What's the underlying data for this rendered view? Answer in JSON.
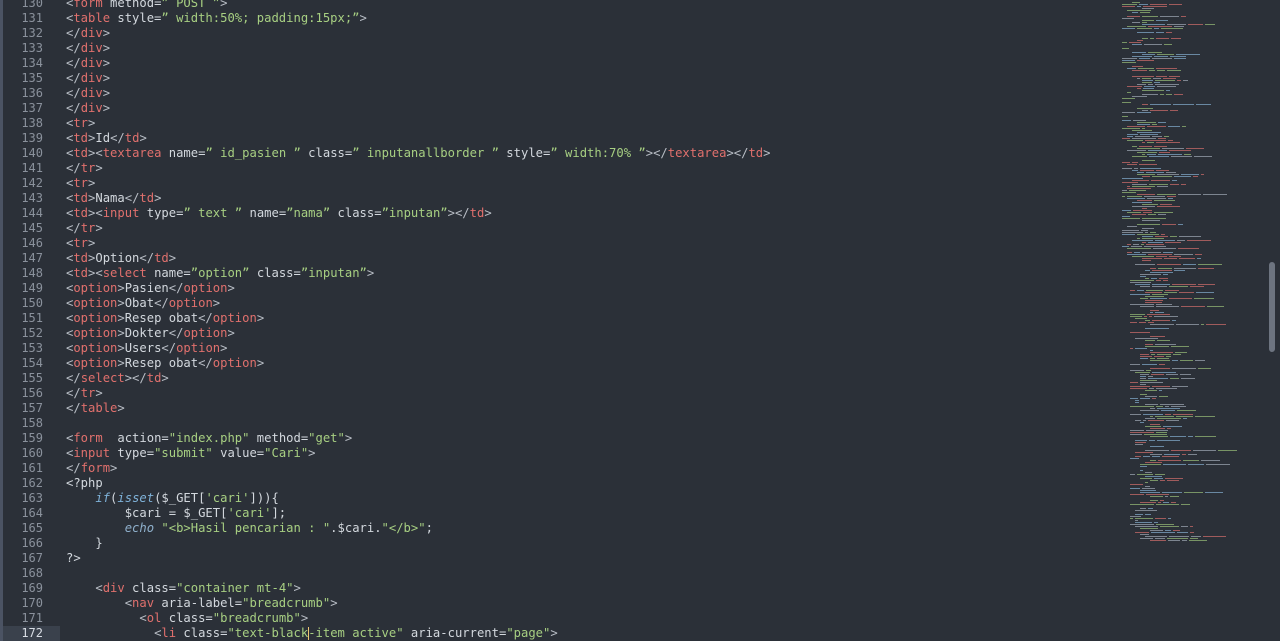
{
  "editor": {
    "active_line": "172",
    "lines": [
      {
        "n": "130",
        "tokens": [
          [
            "br",
            "<"
          ],
          [
            "tag",
            "form"
          ],
          [
            "attr",
            " method="
          ],
          [
            "str",
            "” POST ”"
          ],
          [
            "br",
            ">"
          ]
        ]
      },
      {
        "n": "131",
        "tokens": [
          [
            "br",
            "<"
          ],
          [
            "tag",
            "table"
          ],
          [
            "attr",
            " style="
          ],
          [
            "str",
            "” width:50%; padding:15px;”"
          ],
          [
            "br",
            ">"
          ]
        ]
      },
      {
        "n": "132",
        "tokens": [
          [
            "br",
            "</"
          ],
          [
            "tag",
            "div"
          ],
          [
            "br",
            ">"
          ]
        ]
      },
      {
        "n": "133",
        "tokens": [
          [
            "br",
            "</"
          ],
          [
            "tag",
            "div"
          ],
          [
            "br",
            ">"
          ]
        ]
      },
      {
        "n": "134",
        "tokens": [
          [
            "br",
            "</"
          ],
          [
            "tag",
            "div"
          ],
          [
            "br",
            ">"
          ]
        ]
      },
      {
        "n": "135",
        "tokens": [
          [
            "br",
            "</"
          ],
          [
            "tag",
            "div"
          ],
          [
            "br",
            ">"
          ]
        ]
      },
      {
        "n": "136",
        "tokens": [
          [
            "br",
            "</"
          ],
          [
            "tag",
            "div"
          ],
          [
            "br",
            ">"
          ]
        ]
      },
      {
        "n": "137",
        "tokens": [
          [
            "br",
            "</"
          ],
          [
            "tag",
            "div"
          ],
          [
            "br",
            ">"
          ]
        ]
      },
      {
        "n": "138",
        "tokens": [
          [
            "br",
            "<"
          ],
          [
            "tag",
            "tr"
          ],
          [
            "br",
            ">"
          ]
        ]
      },
      {
        "n": "139",
        "tokens": [
          [
            "br",
            "<"
          ],
          [
            "tag",
            "td"
          ],
          [
            "br",
            ">"
          ],
          [
            "text",
            "Id"
          ],
          [
            "br",
            "</"
          ],
          [
            "tag",
            "td"
          ],
          [
            "br",
            ">"
          ]
        ]
      },
      {
        "n": "140",
        "tokens": [
          [
            "br",
            "<"
          ],
          [
            "tag",
            "td"
          ],
          [
            "br",
            "><"
          ],
          [
            "tag",
            "textarea"
          ],
          [
            "attr",
            " name="
          ],
          [
            "str",
            "” id_pasien ”"
          ],
          [
            "attr",
            " class="
          ],
          [
            "str",
            "” inputanallborder ”"
          ],
          [
            "attr",
            " style="
          ],
          [
            "str",
            "” width:70% ”"
          ],
          [
            "br",
            "></"
          ],
          [
            "tag",
            "textarea"
          ],
          [
            "br",
            "></"
          ],
          [
            "tag",
            "td"
          ],
          [
            "br",
            ">"
          ]
        ]
      },
      {
        "n": "141",
        "tokens": [
          [
            "br",
            "</"
          ],
          [
            "tag",
            "tr"
          ],
          [
            "br",
            ">"
          ]
        ]
      },
      {
        "n": "142",
        "tokens": [
          [
            "br",
            "<"
          ],
          [
            "tag",
            "tr"
          ],
          [
            "br",
            ">"
          ]
        ]
      },
      {
        "n": "143",
        "tokens": [
          [
            "br",
            "<"
          ],
          [
            "tag",
            "td"
          ],
          [
            "br",
            ">"
          ],
          [
            "text",
            "Nama"
          ],
          [
            "br",
            "</"
          ],
          [
            "tag",
            "td"
          ],
          [
            "br",
            ">"
          ]
        ]
      },
      {
        "n": "144",
        "tokens": [
          [
            "br",
            "<"
          ],
          [
            "tag",
            "td"
          ],
          [
            "br",
            "><"
          ],
          [
            "tag",
            "input"
          ],
          [
            "attr",
            " type="
          ],
          [
            "str",
            "” text ”"
          ],
          [
            "attr",
            " name="
          ],
          [
            "str",
            "”nama”"
          ],
          [
            "attr",
            " class="
          ],
          [
            "str",
            "”inputan”"
          ],
          [
            "br",
            "></"
          ],
          [
            "tag",
            "td"
          ],
          [
            "br",
            ">"
          ]
        ]
      },
      {
        "n": "145",
        "tokens": [
          [
            "br",
            "</"
          ],
          [
            "tag",
            "tr"
          ],
          [
            "br",
            ">"
          ]
        ]
      },
      {
        "n": "146",
        "tokens": [
          [
            "br",
            "<"
          ],
          [
            "tag",
            "tr"
          ],
          [
            "br",
            ">"
          ]
        ]
      },
      {
        "n": "147",
        "tokens": [
          [
            "br",
            "<"
          ],
          [
            "tag",
            "td"
          ],
          [
            "br",
            ">"
          ],
          [
            "text",
            "Option"
          ],
          [
            "br",
            "</"
          ],
          [
            "tag",
            "td"
          ],
          [
            "br",
            ">"
          ]
        ]
      },
      {
        "n": "148",
        "tokens": [
          [
            "br",
            "<"
          ],
          [
            "tag",
            "td"
          ],
          [
            "br",
            "><"
          ],
          [
            "tag",
            "select"
          ],
          [
            "attr",
            " name="
          ],
          [
            "str",
            "”option”"
          ],
          [
            "attr",
            " class="
          ],
          [
            "str",
            "”inputan”"
          ],
          [
            "br",
            ">"
          ]
        ]
      },
      {
        "n": "149",
        "tokens": [
          [
            "br",
            "<"
          ],
          [
            "tag",
            "option"
          ],
          [
            "br",
            ">"
          ],
          [
            "text",
            "Pasien"
          ],
          [
            "br",
            "</"
          ],
          [
            "tag",
            "option"
          ],
          [
            "br",
            ">"
          ]
        ]
      },
      {
        "n": "150",
        "tokens": [
          [
            "br",
            "<"
          ],
          [
            "tag",
            "option"
          ],
          [
            "br",
            ">"
          ],
          [
            "text",
            "Obat"
          ],
          [
            "br",
            "</"
          ],
          [
            "tag",
            "option"
          ],
          [
            "br",
            ">"
          ]
        ]
      },
      {
        "n": "151",
        "tokens": [
          [
            "br",
            "<"
          ],
          [
            "tag",
            "option"
          ],
          [
            "br",
            ">"
          ],
          [
            "text",
            "Resep obat"
          ],
          [
            "br",
            "</"
          ],
          [
            "tag",
            "option"
          ],
          [
            "br",
            ">"
          ]
        ]
      },
      {
        "n": "152",
        "tokens": [
          [
            "br",
            "<"
          ],
          [
            "tag",
            "option"
          ],
          [
            "br",
            ">"
          ],
          [
            "text",
            "Dokter"
          ],
          [
            "br",
            "</"
          ],
          [
            "tag",
            "option"
          ],
          [
            "br",
            ">"
          ]
        ]
      },
      {
        "n": "153",
        "tokens": [
          [
            "br",
            "<"
          ],
          [
            "tag",
            "option"
          ],
          [
            "br",
            ">"
          ],
          [
            "text",
            "Users"
          ],
          [
            "br",
            "</"
          ],
          [
            "tag",
            "option"
          ],
          [
            "br",
            ">"
          ]
        ]
      },
      {
        "n": "154",
        "tokens": [
          [
            "br",
            "<"
          ],
          [
            "tag",
            "option"
          ],
          [
            "br",
            ">"
          ],
          [
            "text",
            "Resep obat"
          ],
          [
            "br",
            "</"
          ],
          [
            "tag",
            "option"
          ],
          [
            "br",
            ">"
          ]
        ]
      },
      {
        "n": "155",
        "tokens": [
          [
            "br",
            "</"
          ],
          [
            "tag",
            "select"
          ],
          [
            "br",
            "></"
          ],
          [
            "tag",
            "td"
          ],
          [
            "br",
            ">"
          ]
        ]
      },
      {
        "n": "156",
        "tokens": [
          [
            "br",
            "</"
          ],
          [
            "tag",
            "tr"
          ],
          [
            "br",
            ">"
          ]
        ]
      },
      {
        "n": "157",
        "tokens": [
          [
            "br",
            "</"
          ],
          [
            "tag",
            "table"
          ],
          [
            "br",
            ">"
          ]
        ]
      },
      {
        "n": "158",
        "tokens": []
      },
      {
        "n": "159",
        "tokens": [
          [
            "br",
            "<"
          ],
          [
            "tag",
            "form"
          ],
          [
            "attr",
            "  action="
          ],
          [
            "str",
            "\"index.php\""
          ],
          [
            "attr",
            " method="
          ],
          [
            "str",
            "\"get\""
          ],
          [
            "br",
            ">"
          ]
        ]
      },
      {
        "n": "160",
        "tokens": [
          [
            "br",
            "<"
          ],
          [
            "tag",
            "input"
          ],
          [
            "attr",
            " type="
          ],
          [
            "str",
            "\"submit\""
          ],
          [
            "attr",
            " value="
          ],
          [
            "str",
            "\"Cari\""
          ],
          [
            "br",
            ">"
          ]
        ]
      },
      {
        "n": "161",
        "tokens": [
          [
            "br",
            "</"
          ],
          [
            "tag",
            "form"
          ],
          [
            "br",
            ">"
          ]
        ]
      },
      {
        "n": "162",
        "tokens": [
          [
            "php",
            "<?php"
          ]
        ]
      },
      {
        "n": "163",
        "tokens": [
          [
            "php",
            "    "
          ],
          [
            "fn",
            "if"
          ],
          [
            "php",
            "("
          ],
          [
            "fn",
            "isset"
          ],
          [
            "php",
            "($_GET["
          ],
          [
            "str",
            "'cari'"
          ],
          [
            "php",
            "])){"
          ]
        ]
      },
      {
        "n": "164",
        "tokens": [
          [
            "php",
            "        $cari = $_GET["
          ],
          [
            "str",
            "'cari'"
          ],
          [
            "php",
            "];"
          ]
        ]
      },
      {
        "n": "165",
        "tokens": [
          [
            "php",
            "        "
          ],
          [
            "kw",
            "echo"
          ],
          [
            "php",
            " "
          ],
          [
            "str",
            "\"<b>Hasil pencarian : \""
          ],
          [
            "php",
            "."
          ],
          [
            "var",
            "$cari"
          ],
          [
            "php",
            "."
          ],
          [
            "str",
            "\"</b>\""
          ],
          [
            "php",
            ";"
          ]
        ]
      },
      {
        "n": "166",
        "tokens": [
          [
            "php",
            "    }"
          ]
        ]
      },
      {
        "n": "167",
        "tokens": [
          [
            "php",
            "?>"
          ]
        ]
      },
      {
        "n": "168",
        "tokens": []
      },
      {
        "n": "169",
        "tokens": [
          [
            "php",
            "    "
          ],
          [
            "br",
            "<"
          ],
          [
            "tag",
            "div"
          ],
          [
            "attr",
            " class="
          ],
          [
            "str",
            "\"container mt-4\""
          ],
          [
            "br",
            ">"
          ]
        ]
      },
      {
        "n": "170",
        "tokens": [
          [
            "php",
            "        "
          ],
          [
            "br",
            "<"
          ],
          [
            "tag",
            "nav"
          ],
          [
            "attr",
            " aria-label="
          ],
          [
            "str",
            "\"breadcrumb\""
          ],
          [
            "br",
            ">"
          ]
        ]
      },
      {
        "n": "171",
        "tokens": [
          [
            "php",
            "          "
          ],
          [
            "br",
            "<"
          ],
          [
            "tag",
            "ol"
          ],
          [
            "attr",
            " class="
          ],
          [
            "str",
            "\"breadcrumb\""
          ],
          [
            "br",
            ">"
          ]
        ]
      },
      {
        "n": "172",
        "tokens": [
          [
            "php",
            "            "
          ],
          [
            "br",
            "<"
          ],
          [
            "tag",
            "li"
          ],
          [
            "attr",
            " class="
          ],
          [
            "str",
            "\"text-black"
          ],
          [
            "cursor",
            ""
          ],
          [
            "str",
            "-item active\""
          ],
          [
            "attr",
            " aria-current="
          ],
          [
            "str",
            "\"page\""
          ],
          [
            "br",
            ">"
          ]
        ]
      }
    ]
  },
  "colors": {
    "background": "#2b3038",
    "tag": "#e0706d",
    "string": "#a7cf82",
    "text": "#d3d8de",
    "function": "#7fb2d9",
    "cursor": "#f0c674"
  }
}
